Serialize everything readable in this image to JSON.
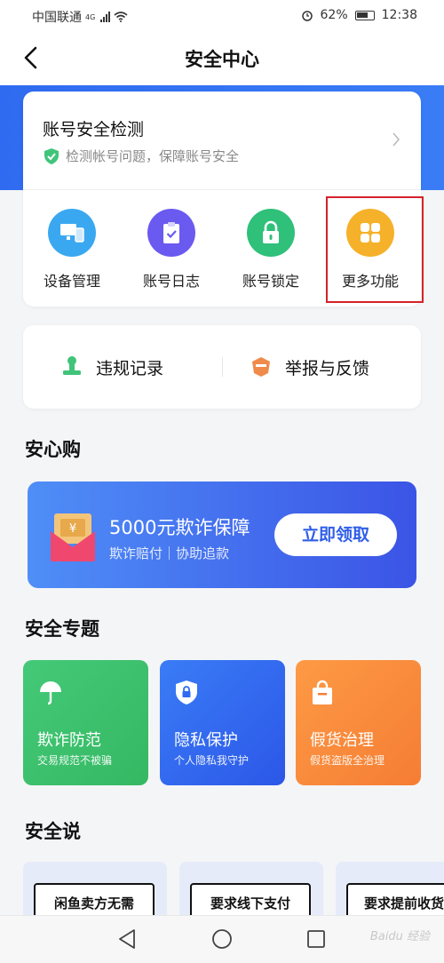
{
  "status": {
    "carrier": "中国联通",
    "net": "4G",
    "battery": "62%",
    "time": "12:38"
  },
  "nav": {
    "title": "安全中心"
  },
  "detect": {
    "title": "账号安全检测",
    "subtitle": "检测帐号问题，保障账号安全"
  },
  "quick": [
    {
      "label": "设备管理",
      "color": "#3aa8f0"
    },
    {
      "label": "账号日志",
      "color": "#6a5af0"
    },
    {
      "label": "账号锁定",
      "color": "#2fc07a"
    },
    {
      "label": "更多功能",
      "color": "#f6b12a"
    }
  ],
  "records": {
    "violation": "违规记录",
    "report": "举报与反馈"
  },
  "sections": {
    "anxin": "安心购",
    "topics": "安全专题",
    "say": "安全说"
  },
  "promo": {
    "title": "5000元欺诈保障",
    "subtitle": "欺诈赔付｜协助追款",
    "button": "立即领取"
  },
  "topics": [
    {
      "title": "欺诈防范",
      "sub": "交易规范不被骗",
      "color": "#3ec46e"
    },
    {
      "title": "隐私保护",
      "sub": "个人隐私我守护",
      "color": "#2e6bf3"
    },
    {
      "title": "假货治理",
      "sub": "假货盗版全治理",
      "color": "#fb8a3c"
    }
  ],
  "say": [
    "闲鱼卖方无需",
    "要求线下支付",
    "要求提前收货"
  ],
  "watermark": "Baidu 经验"
}
